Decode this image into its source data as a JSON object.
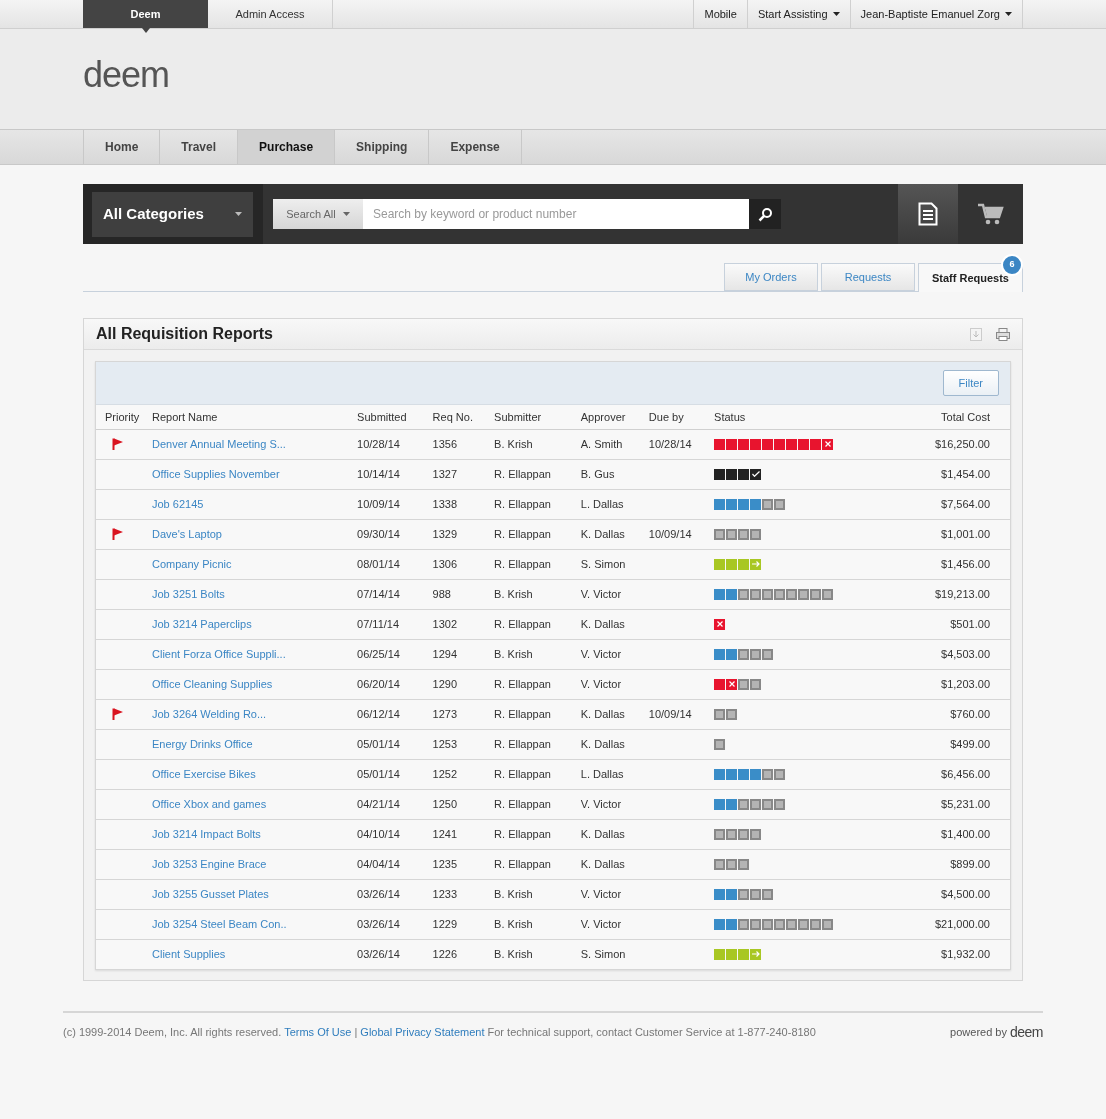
{
  "top_bar": {
    "tabs": [
      {
        "label": "Deem",
        "selected": true
      },
      {
        "label": "Admin Access",
        "selected": false
      }
    ],
    "right_links": [
      {
        "label": "Mobile",
        "dropdown": false
      },
      {
        "label": "Start Assisting",
        "dropdown": true
      },
      {
        "label": "Jean-Baptiste Emanuel Zorg",
        "dropdown": true
      }
    ]
  },
  "logo": "deem",
  "nav": [
    {
      "label": "Home",
      "selected": false
    },
    {
      "label": "Travel",
      "selected": false
    },
    {
      "label": "Purchase",
      "selected": true
    },
    {
      "label": "Shipping",
      "selected": false
    },
    {
      "label": "Expense",
      "selected": false
    }
  ],
  "search_bar": {
    "category": "All Categories",
    "scope": "Search All",
    "placeholder": "Search by keyword or product number"
  },
  "tabs": [
    {
      "label": "My Orders",
      "selected": false
    },
    {
      "label": "Requests",
      "selected": false
    },
    {
      "label": "Staff Requests",
      "selected": true,
      "badge": "6"
    }
  ],
  "panel": {
    "title": "All Requisition Reports",
    "filter_button": "Filter",
    "columns": [
      "Priority",
      "Report Name",
      "Submitted",
      "Req No.",
      "Submitter",
      "Approver",
      "Due by",
      "Status",
      "Total Cost"
    ],
    "rows": [
      {
        "flagged": true,
        "name": "Denver Annual Meeting S...",
        "submitted": "10/28/14",
        "req_no": "1356",
        "submitter": "B. Krish",
        "approver": "A. Smith",
        "due_by": "10/28/14",
        "status": [
          {
            "kind": "rejected"
          },
          {
            "kind": "rejected"
          },
          {
            "kind": "rejected"
          },
          {
            "kind": "rejected"
          },
          {
            "kind": "rejected"
          },
          {
            "kind": "rejected"
          },
          {
            "kind": "rejected"
          },
          {
            "kind": "rejected"
          },
          {
            "kind": "rejected"
          },
          {
            "kind": "rejected-end"
          }
        ],
        "total": "$16,250.00"
      },
      {
        "flagged": false,
        "name": "Office Supplies November",
        "submitted": "10/14/14",
        "req_no": "1327",
        "submitter": "R. Ellappan",
        "approver": "B. Gus",
        "status": [
          {
            "kind": "complete"
          },
          {
            "kind": "complete"
          },
          {
            "kind": "complete"
          },
          {
            "kind": "complete-end"
          }
        ],
        "total": "$1,454.00"
      },
      {
        "flagged": false,
        "name": "Job 62145",
        "submitted": "10/09/14",
        "req_no": "1338",
        "submitter": "R. Ellappan",
        "approver": "L. Dallas",
        "status": [
          {
            "kind": "approved"
          },
          {
            "kind": "approved"
          },
          {
            "kind": "approved"
          },
          {
            "kind": "approved"
          },
          {
            "kind": "pending"
          },
          {
            "kind": "pending"
          }
        ],
        "total": "$7,564.00"
      },
      {
        "flagged": true,
        "name": "Dave's Laptop",
        "submitted": "09/30/14",
        "req_no": "1329",
        "submitter": "R. Ellappan",
        "approver": "K. Dallas",
        "due_by": "10/09/14",
        "status": [
          {
            "kind": "pending"
          },
          {
            "kind": "pending"
          },
          {
            "kind": "pending"
          },
          {
            "kind": "pending"
          }
        ],
        "total": "$1,001.00"
      },
      {
        "flagged": false,
        "name": "Company Picnic",
        "submitted": "08/01/14",
        "req_no": "1306",
        "submitter": "R. Ellappan",
        "approver": "S. Simon",
        "status": [
          {
            "kind": "ordered"
          },
          {
            "kind": "ordered"
          },
          {
            "kind": "ordered"
          },
          {
            "kind": "ordered-end"
          }
        ],
        "total": "$1,456.00"
      },
      {
        "flagged": false,
        "name": "Job 3251 Bolts",
        "submitted": "07/14/14",
        "req_no": "988",
        "submitter": "B. Krish",
        "approver": "V. Victor",
        "status": [
          {
            "kind": "approved"
          },
          {
            "kind": "approved"
          },
          {
            "kind": "pending"
          },
          {
            "kind": "pending"
          },
          {
            "kind": "pending"
          },
          {
            "kind": "pending"
          },
          {
            "kind": "pending"
          },
          {
            "kind": "pending"
          },
          {
            "kind": "pending"
          },
          {
            "kind": "pending"
          }
        ],
        "total": "$19,213.00"
      },
      {
        "flagged": false,
        "name": "Job 3214 Paperclips",
        "submitted": "07/11/14",
        "req_no": "1302",
        "submitter": "R. Ellappan",
        "approver": "K. Dallas",
        "status": [
          {
            "kind": "rejected-end"
          }
        ],
        "total": "$501.00"
      },
      {
        "flagged": false,
        "name": "Client Forza Office Suppli...",
        "submitted": "06/25/14",
        "req_no": "1294",
        "submitter": "B. Krish",
        "approver": "V. Victor",
        "status": [
          {
            "kind": "approved"
          },
          {
            "kind": "approved"
          },
          {
            "kind": "pending"
          },
          {
            "kind": "pending"
          },
          {
            "kind": "pending"
          }
        ],
        "total": "$4,503.00"
      },
      {
        "flagged": false,
        "name": "Office Cleaning Supplies",
        "submitted": "06/20/14",
        "req_no": "1290",
        "submitter": "R. Ellappan",
        "approver": "V. Victor",
        "status": [
          {
            "kind": "rejected"
          },
          {
            "kind": "rejected-end"
          },
          {
            "kind": "pending"
          },
          {
            "kind": "pending"
          }
        ],
        "total": "$1,203.00"
      },
      {
        "flagged": true,
        "name": "Job 3264 Welding Ro...",
        "submitted": "06/12/14",
        "req_no": "1273",
        "submitter": "R. Ellappan",
        "approver": "K. Dallas",
        "due_by": "10/09/14",
        "status": [
          {
            "kind": "pending"
          },
          {
            "kind": "pending"
          }
        ],
        "total": "$760.00"
      },
      {
        "flagged": false,
        "name": "Energy Drinks Office",
        "submitted": "05/01/14",
        "req_no": "1253",
        "submitter": "R. Ellappan",
        "approver": "K. Dallas",
        "status": [
          {
            "kind": "pending"
          }
        ],
        "total": "$499.00"
      },
      {
        "flagged": false,
        "name": "Office Exercise Bikes",
        "submitted": "05/01/14",
        "req_no": "1252",
        "submitter": "R. Ellappan",
        "approver": "L. Dallas",
        "status": [
          {
            "kind": "approved"
          },
          {
            "kind": "approved"
          },
          {
            "kind": "approved"
          },
          {
            "kind": "approved"
          },
          {
            "kind": "pending"
          },
          {
            "kind": "pending"
          }
        ],
        "total": "$6,456.00"
      },
      {
        "flagged": false,
        "name": "Office Xbox and games",
        "submitted": "04/21/14",
        "req_no": "1250",
        "submitter": "R. Ellappan",
        "approver": "V. Victor",
        "status": [
          {
            "kind": "approved"
          },
          {
            "kind": "approved"
          },
          {
            "kind": "pending"
          },
          {
            "kind": "pending"
          },
          {
            "kind": "pending"
          },
          {
            "kind": "pending"
          }
        ],
        "total": "$5,231.00"
      },
      {
        "flagged": false,
        "name": "Job 3214 Impact Bolts",
        "submitted": "04/10/14",
        "req_no": "1241",
        "submitter": "R. Ellappan",
        "approver": "K. Dallas",
        "status": [
          {
            "kind": "pending"
          },
          {
            "kind": "pending"
          },
          {
            "kind": "pending"
          },
          {
            "kind": "pending"
          }
        ],
        "total": "$1,400.00"
      },
      {
        "flagged": false,
        "name": "Job 3253 Engine Brace",
        "submitted": "04/04/14",
        "req_no": "1235",
        "submitter": "R. Ellappan",
        "approver": "K. Dallas",
        "status": [
          {
            "kind": "pending"
          },
          {
            "kind": "pending"
          },
          {
            "kind": "pending"
          }
        ],
        "total": "$899.00"
      },
      {
        "flagged": false,
        "name": "Job 3255 Gusset Plates",
        "submitted": "03/26/14",
        "req_no": "1233",
        "submitter": "B. Krish",
        "approver": "V. Victor",
        "status": [
          {
            "kind": "approved"
          },
          {
            "kind": "approved"
          },
          {
            "kind": "pending"
          },
          {
            "kind": "pending"
          },
          {
            "kind": "pending"
          }
        ],
        "total": "$4,500.00"
      },
      {
        "flagged": false,
        "name": "Job 3254 Steel Beam Con..",
        "submitted": "03/26/14",
        "req_no": "1229",
        "submitter": "B. Krish",
        "approver": "V. Victor",
        "status": [
          {
            "kind": "approved"
          },
          {
            "kind": "approved"
          },
          {
            "kind": "pending"
          },
          {
            "kind": "pending"
          },
          {
            "kind": "pending"
          },
          {
            "kind": "pending"
          },
          {
            "kind": "pending"
          },
          {
            "kind": "pending"
          },
          {
            "kind": "pending"
          },
          {
            "kind": "pending"
          }
        ],
        "total": "$21,000.00"
      },
      {
        "flagged": false,
        "name": "Client Supplies",
        "submitted": "03/26/14",
        "req_no": "1226",
        "submitter": "B. Krish",
        "approver": "S. Simon",
        "status": [
          {
            "kind": "ordered"
          },
          {
            "kind": "ordered"
          },
          {
            "kind": "ordered"
          },
          {
            "kind": "ordered-end"
          }
        ],
        "total": "$1,932.00"
      }
    ]
  },
  "footer": {
    "copyright": "(c) 1999-2014 Deem, Inc. All rights reserved.",
    "links": [
      "Terms Of Use",
      "Global Privacy Statement"
    ],
    "separator": "|",
    "support": "For technical support, contact Customer Service at 1-877-240-8180",
    "powered_by": "powered by",
    "powered_logo": "deem"
  }
}
